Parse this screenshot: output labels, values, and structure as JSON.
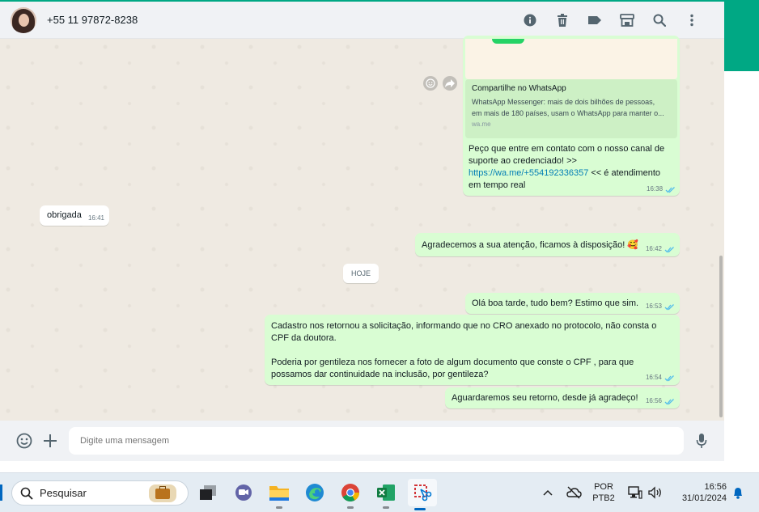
{
  "header": {
    "contact": "+55 11 97872-8238",
    "icons": [
      "info-icon",
      "trash-icon",
      "label-icon",
      "store-icon",
      "search-icon",
      "menu-icon"
    ]
  },
  "messages": {
    "preview_title": "Compartilhe no WhatsApp",
    "preview_desc_1": "WhatsApp Messenger: mais de dois bilhões de pessoas,",
    "preview_desc_2": "em mais de 180 países, usam o WhatsApp para manter o...",
    "preview_domain": "wa.me",
    "m1_line1": "Peço que entre em contato com o nosso canal de",
    "m1_line2": "suporte ao credenciado! >>",
    "m1_link": "https://wa.me/+554192336357",
    "m1_after_link": " << é atendimento",
    "m1_line4": "em tempo real",
    "m1_time": "16:38",
    "m2_text": "obrigada",
    "m2_time": "16:41",
    "m3_text": "Agradecemos a sua atenção, ficamos à disposição! 🥰",
    "m3_time": "16:42",
    "date_chip": "HOJE",
    "m4_text": "Olá boa tarde, tudo bem? Estimo que sim.",
    "m4_time": "16:53",
    "m5_line1": "Cadastro nos retornou a solicitação, informando que no CRO anexado no protocolo, não consta o",
    "m5_line2": "CPF da doutora.",
    "m5_line3": "Poderia por gentileza nos fornecer a foto de algum documento que conste o CPF , para que",
    "m5_line4": "possamos dar continuidade na inclusão, por gentileza?",
    "m5_time": "16:54",
    "m6_text": "Aguardaremos seu retorno, desde já agradeço!",
    "m6_time": "16:56"
  },
  "compose": {
    "placeholder": "Digite uma mensagem"
  },
  "taskbar": {
    "search_label": "Pesquisar",
    "lang_1": "POR",
    "lang_2": "PTB2",
    "clock_time": "16:56",
    "clock_date": "31/01/2024"
  },
  "colors": {
    "accent": "#00a884",
    "outgoing_bubble": "#d9fdd3",
    "incoming_bubble": "#ffffff",
    "chat_bg": "#efeae2",
    "read_ticks": "#53bdeb"
  }
}
